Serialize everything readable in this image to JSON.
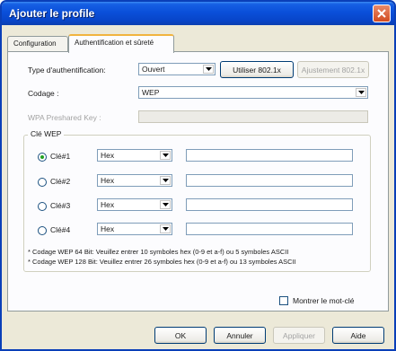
{
  "window": {
    "title": "Ajouter le profile"
  },
  "tabs": [
    {
      "label": "Configuration"
    },
    {
      "label": "Authentification et sûreté"
    }
  ],
  "auth": {
    "type_label": "Type d'authentification:",
    "type_value": "Ouvert",
    "use_8021x_label": "Utiliser 802.1x",
    "adjust_8021x_label": "Ajustement 802.1x"
  },
  "encoding": {
    "label": "Codage :",
    "value": "WEP"
  },
  "wpa": {
    "label": "WPA Preshared Key :",
    "value": ""
  },
  "wep": {
    "group_title": "Clé WEP",
    "keys": [
      {
        "label": "Clé#1",
        "format": "Hex",
        "value": ""
      },
      {
        "label": "Clé#2",
        "format": "Hex",
        "value": ""
      },
      {
        "label": "Clé#3",
        "format": "Hex",
        "value": ""
      },
      {
        "label": "Clé#4",
        "format": "Hex",
        "value": ""
      }
    ],
    "notes": [
      "* Codage WEP 64 Bit: Veuillez entrer 10 symboles hex (0-9 et a-f) ou 5 symboles ASCII",
      "* Codage WEP 128 Bit: Veuillez entrer 26 symboles hex (0-9 et a-f) ou 13 symboles ASCII"
    ]
  },
  "show_key": {
    "label": "Montrer le mot-clé",
    "checked": false
  },
  "buttons": {
    "ok": "OK",
    "cancel": "Annuler",
    "apply": "Appliquer",
    "help": "Aide"
  }
}
